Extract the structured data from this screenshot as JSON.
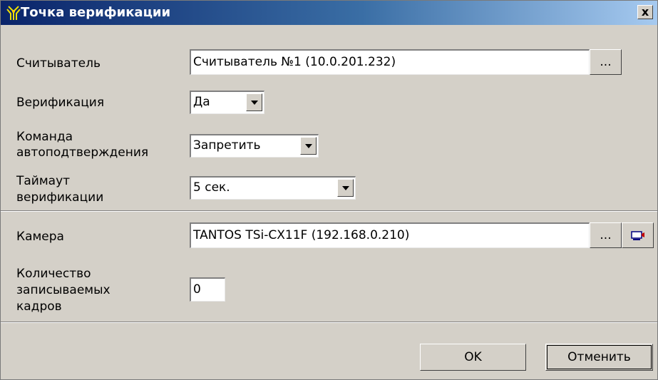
{
  "window": {
    "title": "Точка верификации",
    "close_label": "x"
  },
  "form": {
    "reader": {
      "label": "Считыватель",
      "value": "Считыватель №1 (10.0.201.232)",
      "browse_label": "..."
    },
    "verification": {
      "label": "Верификация",
      "value": "Да"
    },
    "auto_confirm": {
      "label_line1": "Команда",
      "label_line2": "автоподтверждения",
      "value": "Запретить"
    },
    "timeout": {
      "label_line1": "Таймаут",
      "label_line2": "верификации",
      "value": "5 сек."
    },
    "camera": {
      "label": "Камера",
      "value": "TANTOS TSi-CX11F (192.168.0.210)",
      "browse_label": "..."
    },
    "frames": {
      "label_line1": "Количество",
      "label_line2": "записываемых",
      "label_line3": "кадров",
      "value": "0"
    }
  },
  "buttons": {
    "ok": "OK",
    "cancel": "Отменить"
  },
  "colors": {
    "title_start": "#0a246a",
    "title_end": "#a6caf0",
    "dialog_bg": "#d4d0c8"
  },
  "icons": {
    "title": "antenna-icon",
    "camera_view": "camera-view-icon"
  }
}
